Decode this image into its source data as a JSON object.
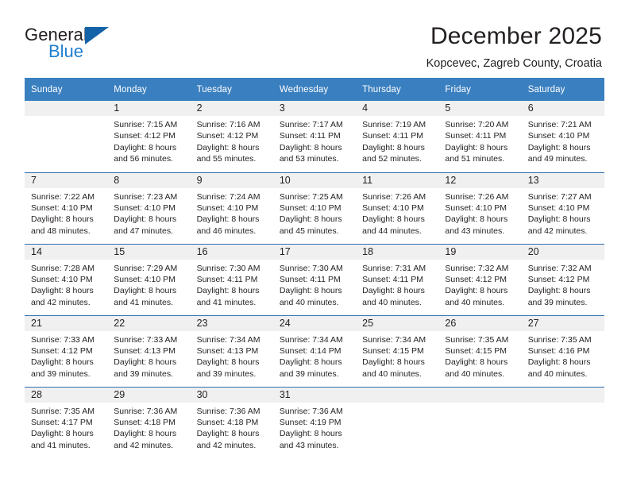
{
  "brand": {
    "name_part1": "General",
    "name_part2": "Blue",
    "accent_color": "#1f7fd0",
    "triangle_color": "#1462a8"
  },
  "header": {
    "title": "December 2025",
    "subtitle": "Kopcevec, Zagreb County, Croatia"
  },
  "calendar": {
    "header_bg": "#3a7fbf",
    "daynum_bg": "#f0f0f0",
    "row_divider_color": "#2f6fad",
    "weekday_headers": [
      "Sunday",
      "Monday",
      "Tuesday",
      "Wednesday",
      "Thursday",
      "Friday",
      "Saturday"
    ],
    "weeks": [
      [
        {
          "day": "",
          "sunrise": "",
          "sunset": "",
          "daylight_line1": "",
          "daylight_line2": ""
        },
        {
          "day": "1",
          "sunrise": "Sunrise: 7:15 AM",
          "sunset": "Sunset: 4:12 PM",
          "daylight_line1": "Daylight: 8 hours",
          "daylight_line2": "and 56 minutes."
        },
        {
          "day": "2",
          "sunrise": "Sunrise: 7:16 AM",
          "sunset": "Sunset: 4:12 PM",
          "daylight_line1": "Daylight: 8 hours",
          "daylight_line2": "and 55 minutes."
        },
        {
          "day": "3",
          "sunrise": "Sunrise: 7:17 AM",
          "sunset": "Sunset: 4:11 PM",
          "daylight_line1": "Daylight: 8 hours",
          "daylight_line2": "and 53 minutes."
        },
        {
          "day": "4",
          "sunrise": "Sunrise: 7:19 AM",
          "sunset": "Sunset: 4:11 PM",
          "daylight_line1": "Daylight: 8 hours",
          "daylight_line2": "and 52 minutes."
        },
        {
          "day": "5",
          "sunrise": "Sunrise: 7:20 AM",
          "sunset": "Sunset: 4:11 PM",
          "daylight_line1": "Daylight: 8 hours",
          "daylight_line2": "and 51 minutes."
        },
        {
          "day": "6",
          "sunrise": "Sunrise: 7:21 AM",
          "sunset": "Sunset: 4:10 PM",
          "daylight_line1": "Daylight: 8 hours",
          "daylight_line2": "and 49 minutes."
        }
      ],
      [
        {
          "day": "7",
          "sunrise": "Sunrise: 7:22 AM",
          "sunset": "Sunset: 4:10 PM",
          "daylight_line1": "Daylight: 8 hours",
          "daylight_line2": "and 48 minutes."
        },
        {
          "day": "8",
          "sunrise": "Sunrise: 7:23 AM",
          "sunset": "Sunset: 4:10 PM",
          "daylight_line1": "Daylight: 8 hours",
          "daylight_line2": "and 47 minutes."
        },
        {
          "day": "9",
          "sunrise": "Sunrise: 7:24 AM",
          "sunset": "Sunset: 4:10 PM",
          "daylight_line1": "Daylight: 8 hours",
          "daylight_line2": "and 46 minutes."
        },
        {
          "day": "10",
          "sunrise": "Sunrise: 7:25 AM",
          "sunset": "Sunset: 4:10 PM",
          "daylight_line1": "Daylight: 8 hours",
          "daylight_line2": "and 45 minutes."
        },
        {
          "day": "11",
          "sunrise": "Sunrise: 7:26 AM",
          "sunset": "Sunset: 4:10 PM",
          "daylight_line1": "Daylight: 8 hours",
          "daylight_line2": "and 44 minutes."
        },
        {
          "day": "12",
          "sunrise": "Sunrise: 7:26 AM",
          "sunset": "Sunset: 4:10 PM",
          "daylight_line1": "Daylight: 8 hours",
          "daylight_line2": "and 43 minutes."
        },
        {
          "day": "13",
          "sunrise": "Sunrise: 7:27 AM",
          "sunset": "Sunset: 4:10 PM",
          "daylight_line1": "Daylight: 8 hours",
          "daylight_line2": "and 42 minutes."
        }
      ],
      [
        {
          "day": "14",
          "sunrise": "Sunrise: 7:28 AM",
          "sunset": "Sunset: 4:10 PM",
          "daylight_line1": "Daylight: 8 hours",
          "daylight_line2": "and 42 minutes."
        },
        {
          "day": "15",
          "sunrise": "Sunrise: 7:29 AM",
          "sunset": "Sunset: 4:10 PM",
          "daylight_line1": "Daylight: 8 hours",
          "daylight_line2": "and 41 minutes."
        },
        {
          "day": "16",
          "sunrise": "Sunrise: 7:30 AM",
          "sunset": "Sunset: 4:11 PM",
          "daylight_line1": "Daylight: 8 hours",
          "daylight_line2": "and 41 minutes."
        },
        {
          "day": "17",
          "sunrise": "Sunrise: 7:30 AM",
          "sunset": "Sunset: 4:11 PM",
          "daylight_line1": "Daylight: 8 hours",
          "daylight_line2": "and 40 minutes."
        },
        {
          "day": "18",
          "sunrise": "Sunrise: 7:31 AM",
          "sunset": "Sunset: 4:11 PM",
          "daylight_line1": "Daylight: 8 hours",
          "daylight_line2": "and 40 minutes."
        },
        {
          "day": "19",
          "sunrise": "Sunrise: 7:32 AM",
          "sunset": "Sunset: 4:12 PM",
          "daylight_line1": "Daylight: 8 hours",
          "daylight_line2": "and 40 minutes."
        },
        {
          "day": "20",
          "sunrise": "Sunrise: 7:32 AM",
          "sunset": "Sunset: 4:12 PM",
          "daylight_line1": "Daylight: 8 hours",
          "daylight_line2": "and 39 minutes."
        }
      ],
      [
        {
          "day": "21",
          "sunrise": "Sunrise: 7:33 AM",
          "sunset": "Sunset: 4:12 PM",
          "daylight_line1": "Daylight: 8 hours",
          "daylight_line2": "and 39 minutes."
        },
        {
          "day": "22",
          "sunrise": "Sunrise: 7:33 AM",
          "sunset": "Sunset: 4:13 PM",
          "daylight_line1": "Daylight: 8 hours",
          "daylight_line2": "and 39 minutes."
        },
        {
          "day": "23",
          "sunrise": "Sunrise: 7:34 AM",
          "sunset": "Sunset: 4:13 PM",
          "daylight_line1": "Daylight: 8 hours",
          "daylight_line2": "and 39 minutes."
        },
        {
          "day": "24",
          "sunrise": "Sunrise: 7:34 AM",
          "sunset": "Sunset: 4:14 PM",
          "daylight_line1": "Daylight: 8 hours",
          "daylight_line2": "and 39 minutes."
        },
        {
          "day": "25",
          "sunrise": "Sunrise: 7:34 AM",
          "sunset": "Sunset: 4:15 PM",
          "daylight_line1": "Daylight: 8 hours",
          "daylight_line2": "and 40 minutes."
        },
        {
          "day": "26",
          "sunrise": "Sunrise: 7:35 AM",
          "sunset": "Sunset: 4:15 PM",
          "daylight_line1": "Daylight: 8 hours",
          "daylight_line2": "and 40 minutes."
        },
        {
          "day": "27",
          "sunrise": "Sunrise: 7:35 AM",
          "sunset": "Sunset: 4:16 PM",
          "daylight_line1": "Daylight: 8 hours",
          "daylight_line2": "and 40 minutes."
        }
      ],
      [
        {
          "day": "28",
          "sunrise": "Sunrise: 7:35 AM",
          "sunset": "Sunset: 4:17 PM",
          "daylight_line1": "Daylight: 8 hours",
          "daylight_line2": "and 41 minutes."
        },
        {
          "day": "29",
          "sunrise": "Sunrise: 7:36 AM",
          "sunset": "Sunset: 4:18 PM",
          "daylight_line1": "Daylight: 8 hours",
          "daylight_line2": "and 42 minutes."
        },
        {
          "day": "30",
          "sunrise": "Sunrise: 7:36 AM",
          "sunset": "Sunset: 4:18 PM",
          "daylight_line1": "Daylight: 8 hours",
          "daylight_line2": "and 42 minutes."
        },
        {
          "day": "31",
          "sunrise": "Sunrise: 7:36 AM",
          "sunset": "Sunset: 4:19 PM",
          "daylight_line1": "Daylight: 8 hours",
          "daylight_line2": "and 43 minutes."
        },
        {
          "day": "",
          "sunrise": "",
          "sunset": "",
          "daylight_line1": "",
          "daylight_line2": ""
        },
        {
          "day": "",
          "sunrise": "",
          "sunset": "",
          "daylight_line1": "",
          "daylight_line2": ""
        },
        {
          "day": "",
          "sunrise": "",
          "sunset": "",
          "daylight_line1": "",
          "daylight_line2": ""
        }
      ]
    ]
  }
}
